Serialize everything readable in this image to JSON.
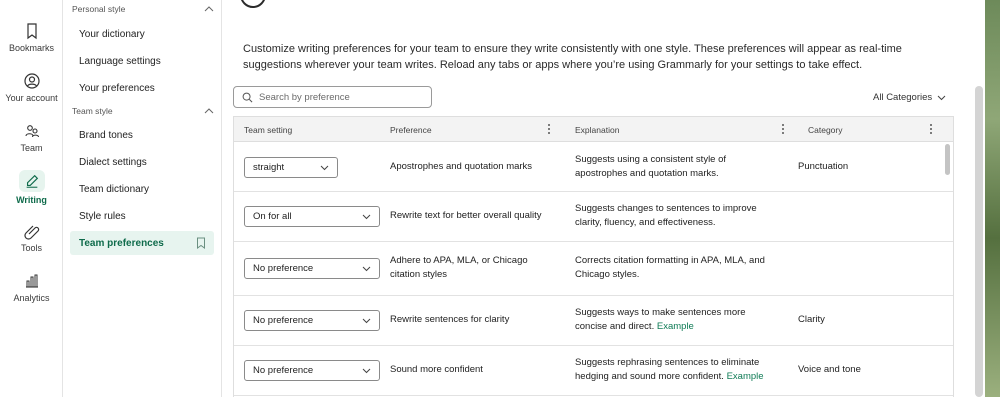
{
  "rail": {
    "items": [
      {
        "label": "Bookmarks",
        "icon": "bookmark-icon"
      },
      {
        "label": "Your account",
        "icon": "user-icon"
      },
      {
        "label": "Team",
        "icon": "team-icon"
      },
      {
        "label": "Writing",
        "icon": "pen-icon",
        "active": true
      },
      {
        "label": "Tools",
        "icon": "paperclip-icon"
      },
      {
        "label": "Analytics",
        "icon": "bar-chart-icon"
      }
    ]
  },
  "sidebar": {
    "personal_header": "Personal style",
    "personal_items": [
      "Your dictionary",
      "Language settings",
      "Your preferences"
    ],
    "team_header": "Team style",
    "team_items": [
      "Brand tones",
      "Dialect settings",
      "Team dictionary",
      "Style rules",
      "Team preferences"
    ]
  },
  "main": {
    "description": "Customize writing preferences for your team to ensure they write consistently with one style. These preferences will appear as real-time suggestions wherever your team writes. Reload any tabs or apps where you’re using Grammarly for your settings to take effect.",
    "search_placeholder": "Search by preference",
    "category_filter": "All Categories"
  },
  "table": {
    "headers": [
      "Team setting",
      "Preference",
      "Explanation",
      "Category"
    ],
    "rows": [
      {
        "setting": "straight",
        "preference": "Apostrophes and quotation marks",
        "explanation": "Suggests using a consistent style of apostrophes and quotation marks.",
        "link": "",
        "category": "Punctuation"
      },
      {
        "setting": "On for all",
        "preference": "Rewrite text for better overall quality",
        "explanation": "Suggests changes to sentences to improve clarity, fluency, and effectiveness.",
        "link": "",
        "category": ""
      },
      {
        "setting": "No preference",
        "preference": "Adhere to APA, MLA, or Chicago citation styles",
        "explanation": "Corrects citation formatting in APA, MLA, and Chicago styles.",
        "link": "",
        "category": ""
      },
      {
        "setting": "No preference",
        "preference": "Rewrite sentences for clarity",
        "explanation": "Suggests ways to make sentences more concise and direct.",
        "link": "Example",
        "category": "Clarity"
      },
      {
        "setting": "No preference",
        "preference": "Sound more confident",
        "explanation": "Suggests rephrasing sentences to eliminate hedging and sound more confident.",
        "link": "Example",
        "category": "Voice and tone"
      }
    ]
  },
  "colors": {
    "accent": "#0f6b4b",
    "active_bg": "#e7f4ef",
    "link": "#0f7b55"
  }
}
